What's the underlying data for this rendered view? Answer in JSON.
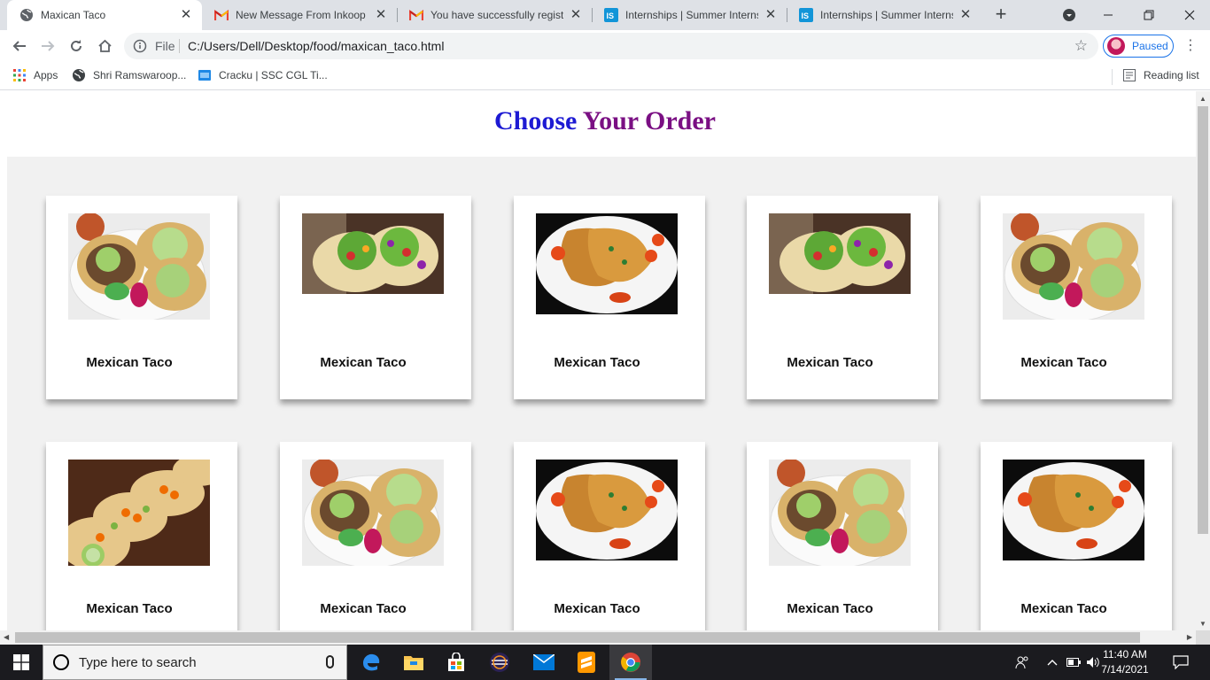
{
  "browser": {
    "tabs": [
      {
        "title": "Maxican Taco",
        "icon": "globe-icon",
        "active": true
      },
      {
        "title": "New Message From Inkoop F",
        "icon": "gmail-icon"
      },
      {
        "title": "You have successfully registe",
        "icon": "gmail-icon"
      },
      {
        "title": "Internships | Summer Internsh",
        "icon": "internshala-icon"
      },
      {
        "title": "Internships | Summer Internsh",
        "icon": "internshala-icon"
      }
    ],
    "toolbar": {
      "scheme_label": "File",
      "url": "C:/Users/Dell/Desktop/food/maxican_taco.html",
      "profile_label": "Paused"
    },
    "bookmarks": [
      {
        "label": "Apps",
        "icon": "apps-grid-icon"
      },
      {
        "label": "Shri Ramswaroop...",
        "icon": "globe-icon"
      },
      {
        "label": "Cracku | SSC CGL Ti...",
        "icon": "cracku-icon"
      }
    ],
    "reading_list_label": "Reading list"
  },
  "page": {
    "title_part1": "Choose",
    "title_part2": "Your Order",
    "cards": [
      {
        "name": "Mexican Taco",
        "image": "tacos-plate"
      },
      {
        "name": "Mexican Taco",
        "image": "tacos-fresh"
      },
      {
        "name": "Mexican Taco",
        "image": "tacos-dark-plate"
      },
      {
        "name": "Mexican Taco",
        "image": "tacos-fresh"
      },
      {
        "name": "Mexican Taco",
        "image": "tacos-plate"
      },
      {
        "name": "Mexican Taco",
        "image": "tacos-board"
      },
      {
        "name": "Mexican Taco",
        "image": "tacos-plate"
      },
      {
        "name": "Mexican Taco",
        "image": "tacos-dark-plate"
      },
      {
        "name": "Mexican Taco",
        "image": "tacos-plate"
      },
      {
        "name": "Mexican Taco",
        "image": "tacos-dark-plate"
      }
    ]
  },
  "taskbar": {
    "search_placeholder": "Type here to search",
    "time": "11:40 AM",
    "date": "7/14/2021"
  },
  "colors": {
    "title_word1": "#1d1ad3",
    "title_word2": "#7a0f83",
    "grid_background": "#f1f1f1",
    "tab_strip": "#dee1e6",
    "profile_accent": "#1a73e8"
  }
}
